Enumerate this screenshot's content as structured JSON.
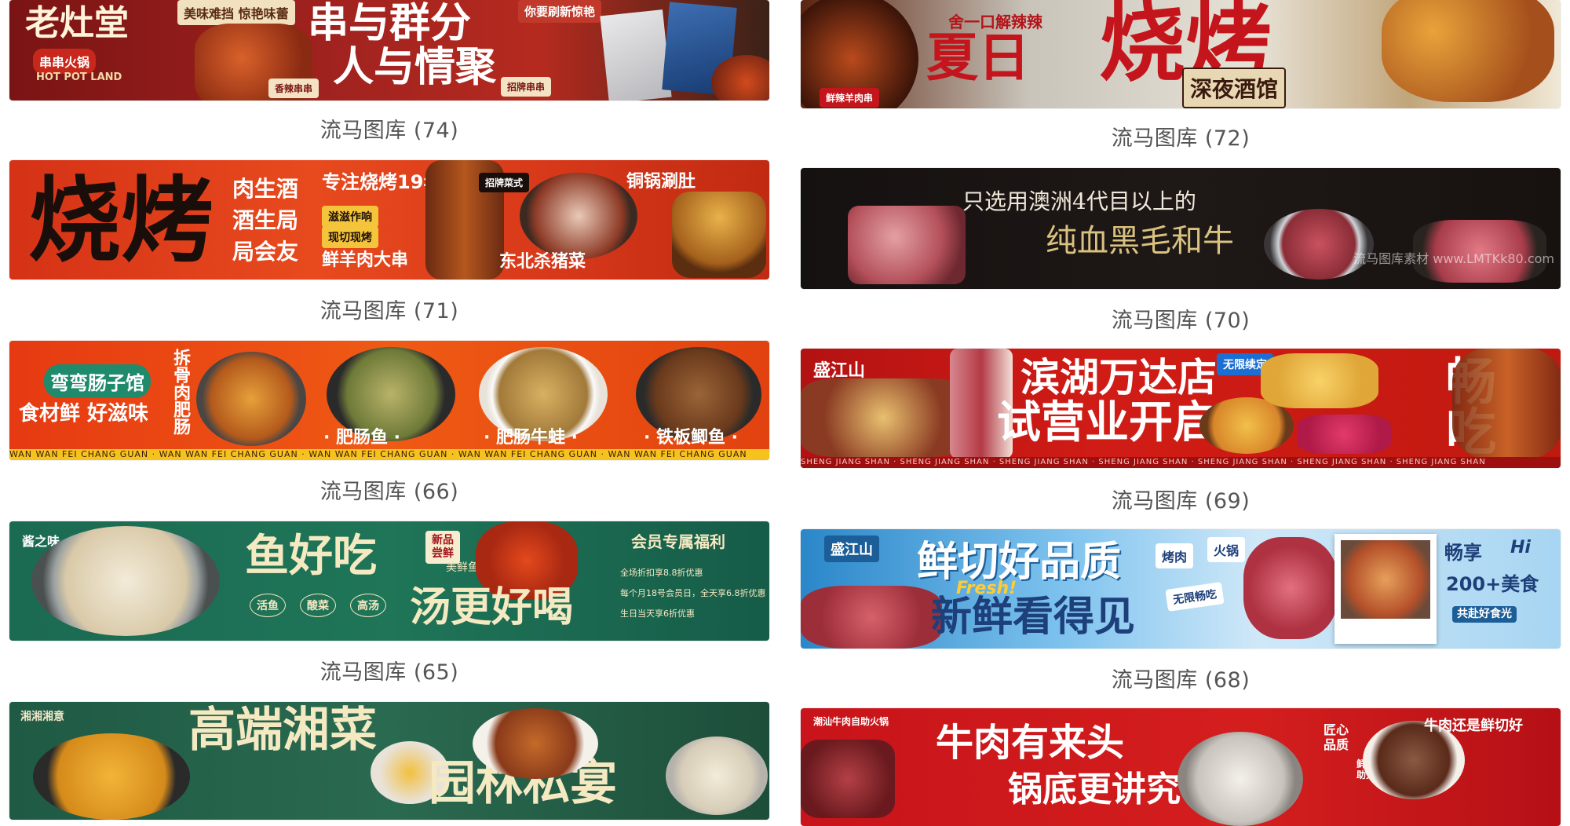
{
  "cards": {
    "c74": {
      "caption": "流马图库 (74)",
      "brand": "老灶堂",
      "brand_sub": "串串火锅",
      "brand_en": "HOT POT LAND",
      "tag": "美味难挡 惊艳味蕾",
      "headline_1": "串与群分",
      "headline_2": "人与情聚",
      "tag_2": "你要刷新惊艳",
      "tag_3": "香辣串串",
      "tag_4": "招牌串串"
    },
    "c72": {
      "caption": "流马图库 (72)",
      "tag": "舍一口解辣辣",
      "headline_1": "夏日",
      "headline_2": "烧烤",
      "sub": "深夜酒馆",
      "tag_2": "鲜辣羊肉串"
    },
    "c71": {
      "caption": "流马图库 (71)",
      "headline": "烧烤",
      "sub_1": "肉生酒",
      "sub_2": "酒生局",
      "sub_3": "局会友",
      "sub_4": "专注烧烤19年",
      "sub_5": "滋滋作响",
      "sub_6": "现切现烤",
      "sub_7": "鲜羊肉大串",
      "sub_8": "东北杀猪菜",
      "sub_9": "铜锅涮肚",
      "sub_10": "招牌菜式"
    },
    "c70": {
      "caption": "流马图库 (70)",
      "line_1": "只选用澳洲4代目以上的",
      "line_2": "纯血黑毛和牛",
      "watermark": "流马图库素材    www.LMTKk80.com"
    },
    "c66": {
      "caption": "流马图库 (66)",
      "brand": "弯弯肠子馆",
      "slogan": "食材鲜 好滋味",
      "vertical": "拆骨肉肥肠",
      "dish_1": "· 肥肠鱼 ·",
      "dish_2": "· 肥肠牛蛙 ·",
      "dish_3": "· 铁板鲫鱼 ·",
      "strip": "WAN WAN FEI CHANG GUAN    ·    WAN WAN FEI CHANG GUAN    ·    WAN WAN FEI CHANG GUAN    ·    WAN WAN FEI CHANG GUAN    ·    WAN WAN FEI CHANG GUAN"
    },
    "c69": {
      "caption": "流马图库 (69)",
      "brand": "盛江山",
      "headline_1": "滨湖万达店",
      "headline_2": "试营业开启",
      "tag": "无限续定",
      "side": "畅吃",
      "strip": "SHENG JIANG SHAN   ·   SHENG JIANG SHAN   ·   SHENG JIANG SHAN   ·   SHENG JIANG SHAN   ·   SHENG JIANG SHAN   ·   SHENG JIANG SHAN   ·   SHENG JIANG SHAN"
    },
    "c65": {
      "caption": "流马图库 (65)",
      "brand": "酱之味",
      "headline_1": "鱼好吃",
      "headline_2": "汤更好喝",
      "tag_new": "新品尝鲜",
      "sub": "美鲜鱼头锅",
      "badge_1": "活鱼",
      "badge_2": "酸菜",
      "badge_3": "高汤",
      "perk_title": "会员专属福利",
      "perk_1": "全场折扣享8.8折优惠",
      "perk_2": "每个月18号会员日，全天享6.8折优惠",
      "perk_3": "生日当天享6折优惠"
    },
    "c68": {
      "caption": "流马图库 (68)",
      "brand": "盛江山",
      "headline_1": "鲜切好品质",
      "headline_2": "新鲜看得见",
      "fresh": "Fresh!",
      "tag_1": "烤肉",
      "tag_2": "火锅",
      "tag_3": "无限畅吃",
      "side_1": "畅享",
      "side_2": "Hi",
      "side_3": "200+美食",
      "side_4": "共赴好食光"
    },
    "c_hunan": {
      "brand": "湘湘湘意",
      "headline_1": "高端湘菜",
      "headline_2": "园林私宴"
    },
    "c_beef": {
      "brand": "潮汕牛肉自助火锅",
      "headline_1": "牛肉有来头",
      "headline_2": "锅底更讲究",
      "tag_1": "匠心品质",
      "tag_2": "鲜切牛肉 自助火锅",
      "side": "牛肉还是鲜切好"
    }
  }
}
